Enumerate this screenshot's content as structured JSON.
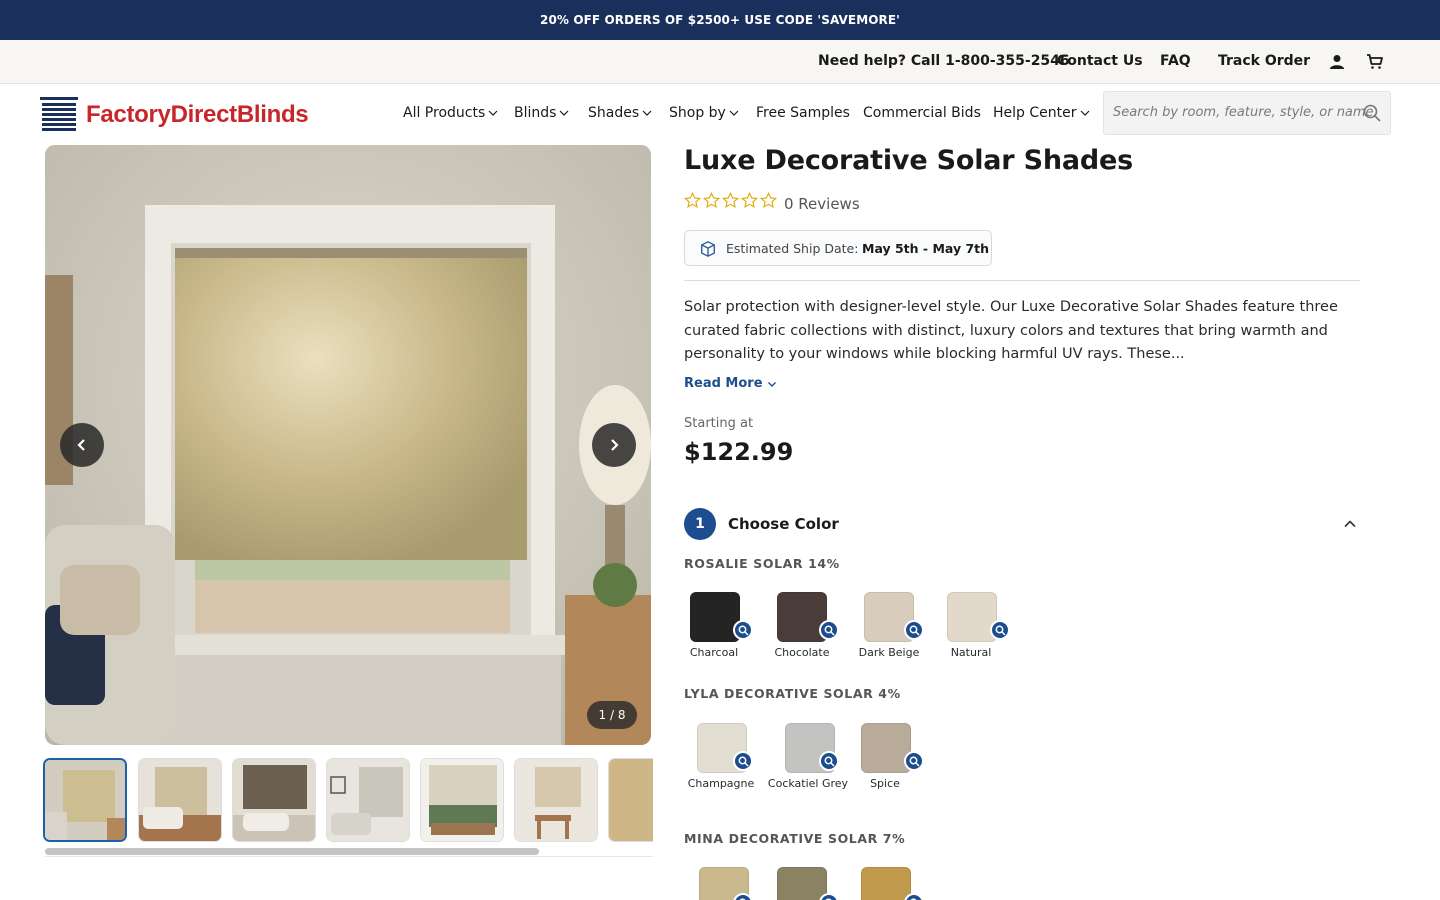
{
  "promo": {
    "text": "20% OFF ORDERS OF $2500+ USE CODE 'SAVEMORE'"
  },
  "utility": {
    "help": "Need help? Call 1-800-355-2546",
    "contact": "Contact Us",
    "faq": "FAQ",
    "track": "Track Order",
    "account_icon": "user-icon",
    "cart_icon": "cart-icon"
  },
  "header": {
    "logo": "FactoryDirectBlinds",
    "menu": [
      {
        "label": "All Products",
        "dropdown": true
      },
      {
        "label": "Blinds",
        "dropdown": true
      },
      {
        "label": "Shades",
        "dropdown": true
      },
      {
        "label": "Shop by",
        "dropdown": true
      },
      {
        "label": "Free Samples",
        "dropdown": false
      },
      {
        "label": "Commercial Bids",
        "dropdown": false
      },
      {
        "label": "Help Center",
        "dropdown": true
      }
    ],
    "search_placeholder": "Search by room, feature, style, or name"
  },
  "gallery": {
    "counter": "1 / 8",
    "thumbnail_count": 7
  },
  "product": {
    "title": "Luxe Decorative Solar Shades",
    "rating": 0,
    "reviews": "0 Reviews",
    "ship_label": "Estimated Ship Date:",
    "ship_value": "May 5th - May 7th",
    "description": "Solar protection with designer-level style. Our Luxe Decorative Solar Shades feature three curated fabric collections with distinct, luxury colors and textures that bring warmth and personality to your windows while blocking harmful UV rays. These...",
    "read_more": "Read More",
    "starting_label": "Starting at",
    "price": "$122.99"
  },
  "step": {
    "number": "1",
    "label": "Choose Color"
  },
  "groups": [
    {
      "name": "ROSALIE SOLAR 14%",
      "colors": [
        {
          "label": "Charcoal",
          "swatch": "#242424"
        },
        {
          "label": "Chocolate",
          "swatch": "#4a3d39"
        },
        {
          "label": "Dark Beige",
          "swatch": "#d8ccbc"
        },
        {
          "label": "Natural",
          "swatch": "#e2d9cb"
        }
      ]
    },
    {
      "name": "LYLA DECORATIVE SOLAR 4%",
      "colors": [
        {
          "label": "Champagne",
          "swatch": "#e3ded2"
        },
        {
          "label": "Cockatiel Grey",
          "swatch": "#c3c3c1"
        },
        {
          "label": "Spice",
          "swatch": "#b9ab9a"
        }
      ]
    },
    {
      "name": "MINA DECORATIVE SOLAR 7%",
      "colors": [
        {
          "label": "",
          "swatch": "#c9b98d"
        },
        {
          "label": "",
          "swatch": "#8a8260"
        },
        {
          "label": "",
          "swatch": "#c29a4e"
        }
      ]
    }
  ],
  "colors": {
    "promo_bg": "#1b2f5c",
    "brand_red": "#c8262a",
    "accent_blue": "#1b4d8f"
  }
}
